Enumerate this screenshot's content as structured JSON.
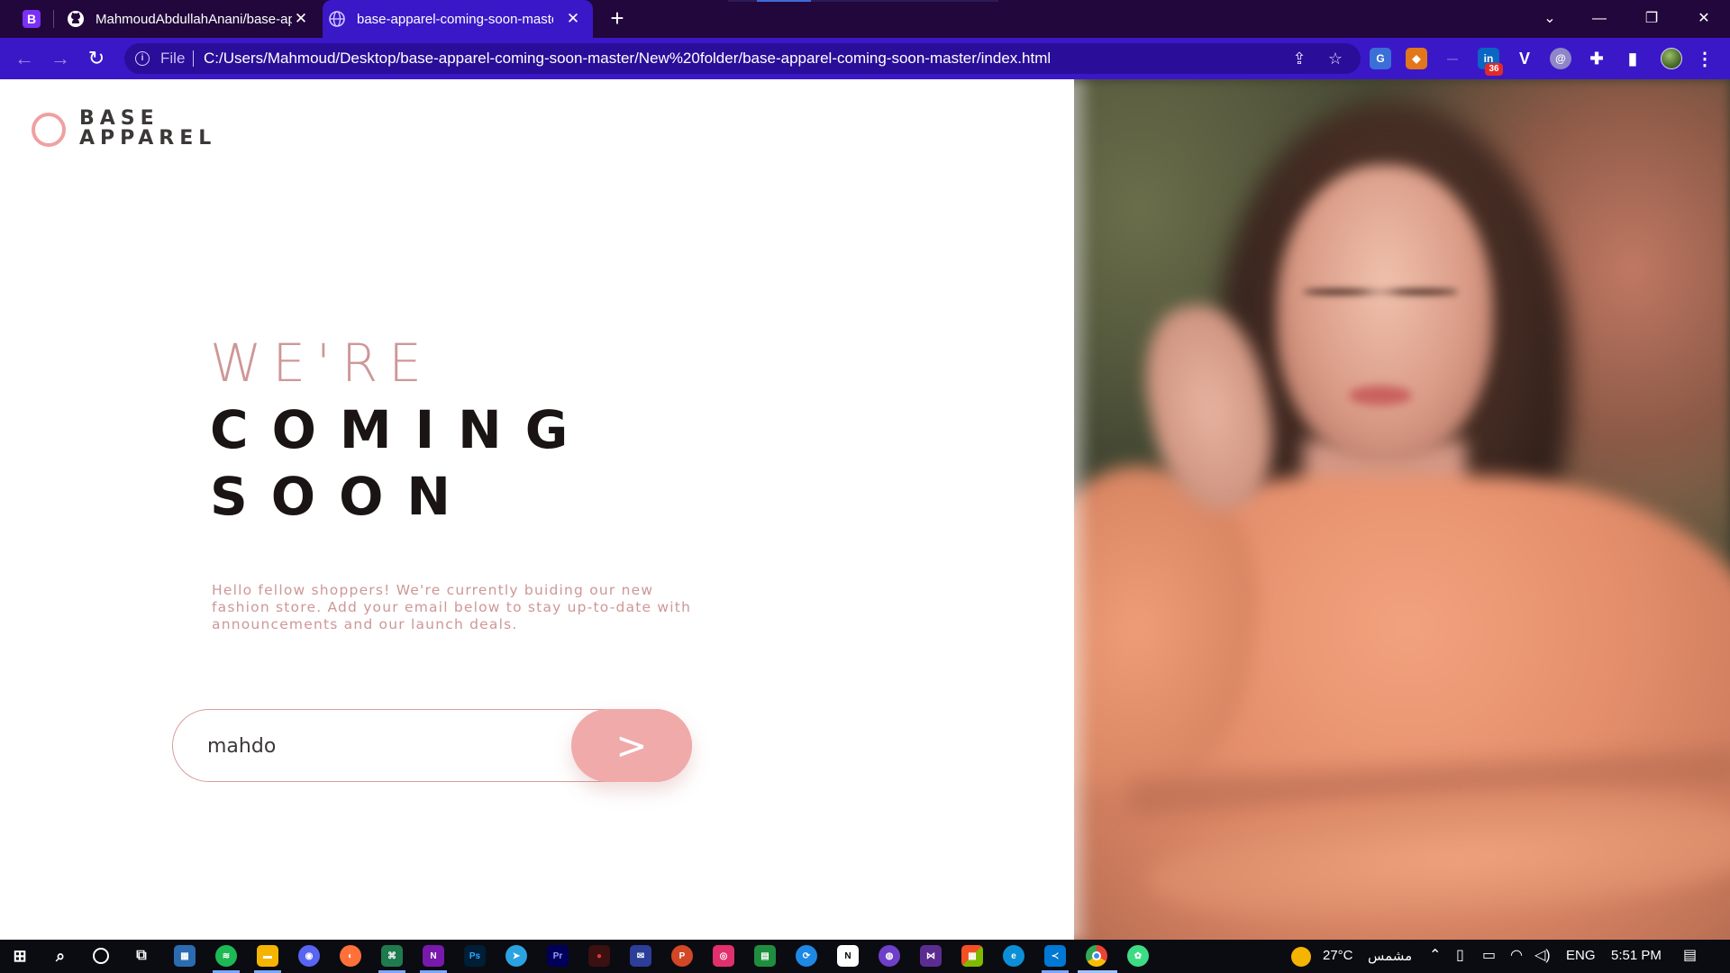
{
  "browser": {
    "tabs": [
      {
        "title": "MahmoudAbdullahAnani/base-apparel-coming-soon",
        "favicon": "github-icon",
        "active": false
      },
      {
        "title": "base-apparel-coming-soon-master",
        "favicon": "globe-icon",
        "active": true
      }
    ],
    "address_bar": {
      "scheme_label": "File",
      "url": "C:/Users/Mahmoud/Desktop/base-apparel-coming-soon-master/New%20folder/base-apparel-coming-soon-master/index.html"
    },
    "extensions_badge": "36",
    "accent_color": "#3a18c8",
    "tabstrip_color": "#21073b"
  },
  "page": {
    "logo": {
      "line1": "BASE",
      "line2": "APPAREL"
    },
    "headline": {
      "light": "WE'RE",
      "dark_line1": "COMING",
      "dark_line2": "SOON"
    },
    "intro": "Hello fellow shoppers! We're currently buiding our new fashion store. Add your email below to stay up-to-date with announcements and our launch deals.",
    "email_input": {
      "value": "mahdo",
      "placeholder": ""
    },
    "submit_label": ">",
    "colors": {
      "pink": "#ce9797",
      "button": "#f0aaaa",
      "dark": "#3c3838"
    }
  },
  "taskbar": {
    "weather": {
      "temp": "27°C",
      "condition": "مشمس"
    },
    "language": "ENG",
    "time": "5:51 PM"
  }
}
